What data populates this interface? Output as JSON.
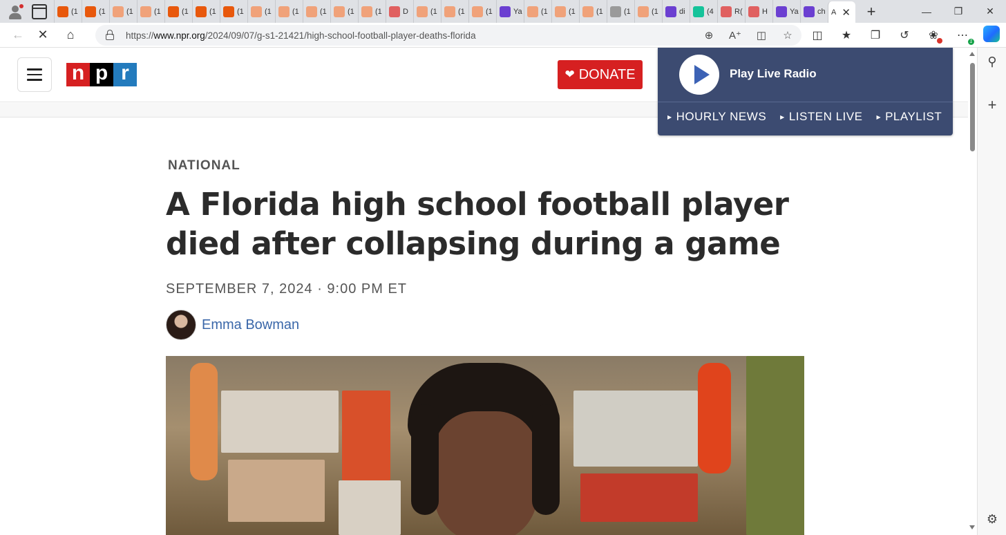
{
  "browser": {
    "tabs": [
      {
        "favicon": "o",
        "text": "(1"
      },
      {
        "favicon": "o",
        "text": "(1"
      },
      {
        "favicon": "lo",
        "text": "(1"
      },
      {
        "favicon": "lo",
        "text": "(1"
      },
      {
        "favicon": "o",
        "text": "(1"
      },
      {
        "favicon": "o",
        "text": "(1"
      },
      {
        "favicon": "o",
        "text": "(1"
      },
      {
        "favicon": "lo",
        "text": "(1"
      },
      {
        "favicon": "lo",
        "text": "(1"
      },
      {
        "favicon": "lo",
        "text": "(1"
      },
      {
        "favicon": "lo",
        "text": "(1"
      },
      {
        "favicon": "lo",
        "text": "(1"
      },
      {
        "favicon": "yt",
        "text": "D"
      },
      {
        "favicon": "lo",
        "text": "(1"
      },
      {
        "favicon": "lo",
        "text": "(1"
      },
      {
        "favicon": "lo",
        "text": "(1"
      },
      {
        "favicon": "y",
        "text": "Ya"
      },
      {
        "favicon": "lo",
        "text": "(1"
      },
      {
        "favicon": "lo",
        "text": "(1"
      },
      {
        "favicon": "lo",
        "text": "(1"
      },
      {
        "favicon": "pic",
        "text": "(1"
      },
      {
        "favicon": "lo",
        "text": "(1"
      },
      {
        "favicon": "y",
        "text": "di"
      },
      {
        "favicon": "g",
        "text": "(4"
      },
      {
        "favicon": "yt",
        "text": "R("
      },
      {
        "favicon": "yt",
        "text": "H"
      },
      {
        "favicon": "y",
        "text": "Ya"
      },
      {
        "favicon": "y",
        "text": "ch"
      }
    ],
    "active_tab_text": "A",
    "active_tab_close": "✕",
    "new_tab": "+",
    "url_prefix": "https://",
    "url_host": "www.npr.org",
    "url_path": "/2024/09/07/g-s1-21421/high-school-football-player-deaths-florida"
  },
  "npr": {
    "logo": {
      "n": "n",
      "p": "p",
      "r": "r"
    },
    "donate_label": "DONATE",
    "radio": {
      "play_label": "Play Live Radio",
      "links": [
        "HOURLY NEWS",
        "LISTEN LIVE",
        "PLAYLIST"
      ]
    }
  },
  "article": {
    "slug": "NATIONAL",
    "headline": "A Florida high school football player died after collapsing during a game",
    "dateline": "SEPTEMBER 7, 2024 · 9:00 PM ET",
    "author": "Emma Bowman"
  },
  "colors": {
    "npr_red": "#d62021",
    "npr_blue": "#237bbd",
    "radio_panel": "#3c4b71",
    "link_blue": "#3a67a9"
  }
}
